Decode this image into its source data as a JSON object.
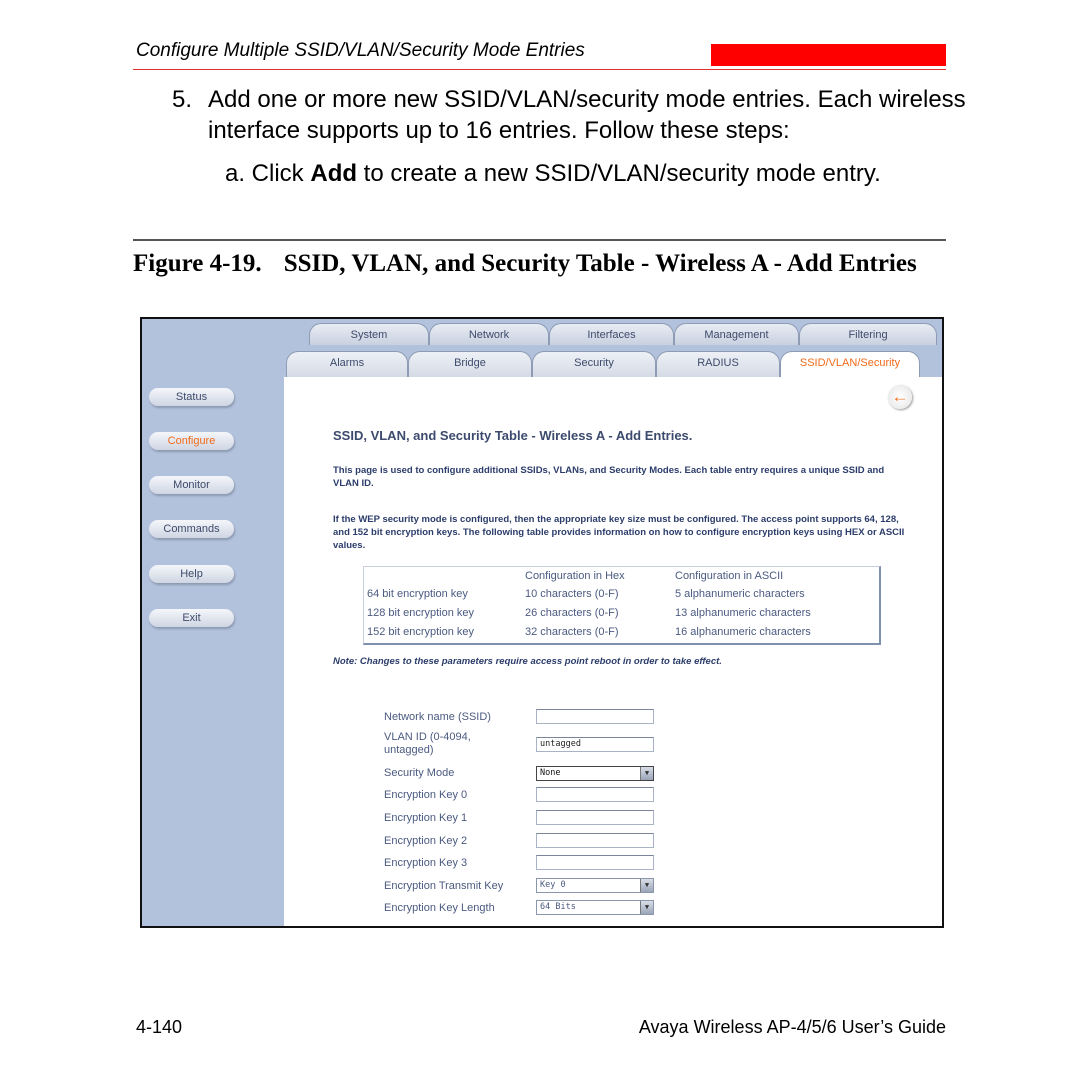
{
  "header": {
    "title": "Configure Multiple SSID/VLAN/Security Mode Entries",
    "accent_color": "#ff0000"
  },
  "step": {
    "number": "5.",
    "text": "Add one or more new SSID/VLAN/security mode entries. Each wireless interface supports up to 16 entries. Follow these steps:"
  },
  "substep": {
    "prefix": "a. Click ",
    "bold": "Add",
    "suffix": " to create a new SSID/VLAN/security mode entry."
  },
  "figure": {
    "label": "Figure 4-19.",
    "caption": "SSID, VLAN, and Security Table - Wireless A - Add Entries"
  },
  "screenshot": {
    "sidebar": [
      {
        "label": "Status",
        "active": false
      },
      {
        "label": "Configure",
        "active": true
      },
      {
        "label": "Monitor",
        "active": false
      },
      {
        "label": "Commands",
        "active": false
      },
      {
        "label": "Help",
        "active": false
      },
      {
        "label": "Exit",
        "active": false
      }
    ],
    "tabs_row1": [
      "System",
      "Network",
      "Interfaces",
      "Management",
      "Filtering"
    ],
    "tabs_row2": [
      "Alarms",
      "Bridge",
      "Security",
      "RADIUS",
      "SSID/VLAN/Security"
    ],
    "active_tab": "SSID/VLAN/Security",
    "back_icon": "back-arrow-icon",
    "title": "SSID, VLAN, and Security Table - Wireless A - Add Entries.",
    "para1": "This page is used to configure additional SSIDs, VLANs, and Security Modes. Each table entry requires a unique SSID and VLAN ID.",
    "para2": "If the WEP security mode is configured, then the appropriate key size must be configured. The access point supports 64, 128, and 152 bit encryption keys. The following table provides information on how to configure encryption keys using HEX or ASCII values.",
    "key_table": {
      "headers": [
        "",
        "Configuration in Hex",
        "Configuration in ASCII"
      ],
      "rows": [
        [
          "64 bit encryption key",
          "10 characters (0-F)",
          "5 alphanumeric characters"
        ],
        [
          "128 bit encryption key",
          "26 characters (0-F)",
          "13 alphanumeric characters"
        ],
        [
          "152 bit encryption key",
          "32 characters (0-F)",
          "16 alphanumeric characters"
        ]
      ]
    },
    "note": "Note: Changes to these parameters require access point reboot in order to take effect.",
    "form": {
      "ssid_label": "Network name (SSID)",
      "ssid_value": "",
      "vlan_label": "VLAN ID (0-4094, untagged)",
      "vlan_value": "untagged",
      "security_mode_label": "Security Mode",
      "security_mode_value": "None",
      "key0_label": "Encryption Key 0",
      "key0_value": "",
      "key1_label": "Encryption Key 1",
      "key1_value": "",
      "key2_label": "Encryption Key 2",
      "key2_value": "",
      "key3_label": "Encryption Key 3",
      "key3_value": "",
      "transmit_key_label": "Encryption Transmit Key",
      "transmit_key_value": "Key 0",
      "key_length_label": "Encryption Key Length",
      "key_length_value": "64 Bits"
    }
  },
  "footer": {
    "page_number": "4-140",
    "guide_title": "Avaya Wireless AP-4/5/6 User’s Guide"
  }
}
